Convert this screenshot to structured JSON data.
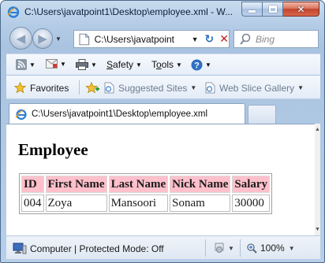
{
  "window": {
    "title": "C:\\Users\\javatpoint1\\Desktop\\employee.xml - W...",
    "icon": "ie-logo-icon"
  },
  "address_bar": {
    "value": "C:\\Users\\javatpoint",
    "search_placeholder": "Bing"
  },
  "command_bar": {
    "safety_label": "Safety",
    "tools_label": "Tools"
  },
  "favorites_bar": {
    "favorites_label": "Favorites",
    "suggested_sites_label": "Suggested Sites",
    "web_slice_label": "Web Slice Gallery"
  },
  "tab": {
    "label": "C:\\Users\\javatpoint1\\Desktop\\employee.xml"
  },
  "page": {
    "title": "Employee",
    "table": {
      "headers": [
        "ID",
        "First Name",
        "Last Name",
        "Nick Name",
        "Salary"
      ],
      "rows": [
        [
          "004",
          "Zoya",
          "Mansoori",
          "Sonam",
          "30000"
        ]
      ],
      "header_color": "#ffc0cb"
    }
  },
  "status_bar": {
    "zone_text": "Computer | Protected Mode: Off",
    "zoom": "100%"
  },
  "colors": {
    "chrome": "#b4cce6",
    "close_button": "#c2452c",
    "table_header": "#ffc0cb"
  }
}
